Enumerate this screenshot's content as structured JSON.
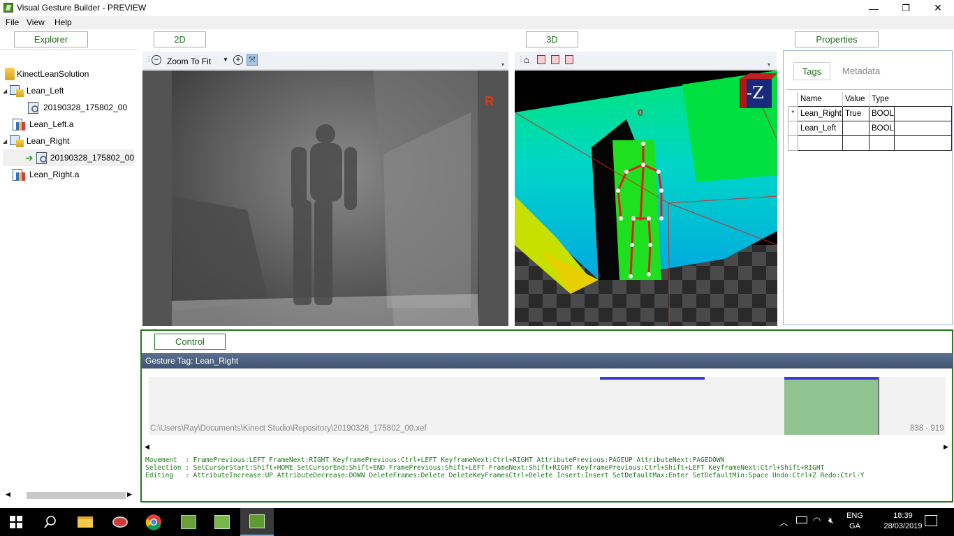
{
  "window": {
    "title": "Visual Gesture Builder - PREVIEW",
    "controls": {
      "minimize": "—",
      "restore": "❐",
      "close": "✕"
    }
  },
  "menu": [
    "File",
    "View",
    "Help"
  ],
  "panels": {
    "explorer": "Explorer",
    "view2d": "2D",
    "view3d": "3D",
    "properties": "Properties",
    "control": "Control"
  },
  "explorer": {
    "items": [
      {
        "label": "KinectLeanSolution",
        "type": "solution"
      },
      {
        "label": "Lean_Left",
        "type": "project",
        "expander": "◢"
      },
      {
        "label": "20190328_175802_00",
        "type": "clip"
      },
      {
        "label": "Lean_Left.a",
        "type": "database"
      },
      {
        "label": "Lean_Right",
        "type": "project",
        "expander": "◢"
      },
      {
        "label": "20190328_175802_00",
        "type": "clip",
        "selected": true
      },
      {
        "label": "Lean_Right.a",
        "type": "database"
      }
    ]
  },
  "toolbar2d": {
    "zoom_value": "Zoom To Fit"
  },
  "viewer2d": {
    "overlay_letter": "R"
  },
  "viewer3d": {
    "tracked_id": "0",
    "axis_label": "-Z"
  },
  "properties": {
    "tabs": [
      "Tags",
      "Metadata"
    ],
    "active_tab": "Tags",
    "columns": [
      "Name",
      "Value",
      "Type"
    ],
    "rows": [
      {
        "marker": "*",
        "name": "Lean_Right",
        "value": "True",
        "type": "BOOL"
      },
      {
        "marker": "",
        "name": "Lean_Left",
        "value": "",
        "type": "BOOL"
      },
      {
        "marker": "",
        "name": "",
        "value": "",
        "type": ""
      }
    ]
  },
  "control": {
    "gesture_tag": "Gesture Tag: Lean_Right",
    "file_path": "C:\\Users\\Ray\\Documents\\Kinect Studio\\Repository\\20190328_175802_00.xef",
    "frame_range": "838 - 919",
    "shortcuts": [
      "Movement  : FramePrevious:LEFT FrameNext:RIGHT KeyframePrevious:Ctrl+LEFT KeyframeNext:Ctrl+RIGHT AttributePrevious:PAGEUP AttributeNext:PAGEDOWN",
      "Selection : SetCursorStart:Shift+HOME SetCursorEnd:Shift+END FramePrevious:Shift+LEFT FrameNext:Shift+RIGHT KeyframePrevious:Ctrl+Shift+LEFT KeyframeNext:Ctrl+Shift+RIGHT",
      "Editing   : AttributeIncrease:UP AttributeDecrease:DOWN DeleteFrames:Delete DeleteKeyFramesCtrl+Delete Insert:Insert SetDefaultMax:Enter SetDefaultMin:Space Undo:Ctrl+Z Redo:Ctrl-Y"
    ]
  },
  "taskbar": {
    "language_top": "ENG",
    "language_bottom": "GA",
    "time": "18:39",
    "date": "28/03/2019"
  },
  "colors": {
    "accent_green": "#1e7a1e",
    "tag_bar": "#8fc38f",
    "timeline_mark": "#3a3ad8"
  }
}
